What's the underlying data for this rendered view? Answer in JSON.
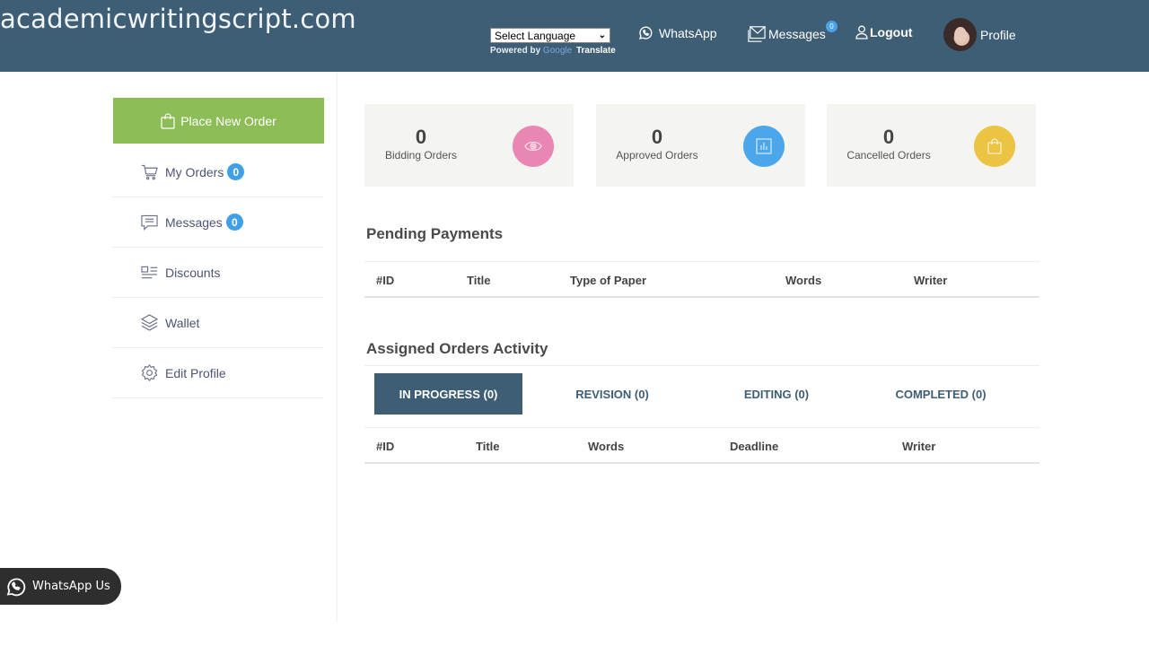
{
  "header": {
    "site_title": "academicwritingscript.com",
    "language_select": {
      "selected": "Select Language"
    },
    "powered_by": "Powered by",
    "google": "Google",
    "translate": "Translate",
    "nav": {
      "whatsapp": "WhatsApp",
      "messages": "Messages",
      "messages_badge": "0",
      "logout": "Logout",
      "profile": "Profile"
    }
  },
  "sidebar": {
    "place_order": "Place New Order",
    "items": [
      {
        "label": "My Orders",
        "icon": "cart-icon",
        "badge": "0"
      },
      {
        "label": "Messages",
        "icon": "chat-icon",
        "badge": "0"
      },
      {
        "label": "Discounts",
        "icon": "discount-list-icon"
      },
      {
        "label": "Wallet",
        "icon": "layers-icon"
      },
      {
        "label": "Edit Profile",
        "icon": "gear-icon"
      }
    ]
  },
  "stats": [
    {
      "value": "0",
      "label": "Bidding Orders",
      "icon": "eye-icon",
      "color": "#ea86b3"
    },
    {
      "value": "0",
      "label": "Approved Orders",
      "icon": "chart-icon",
      "color": "#4ba7ea"
    },
    {
      "value": "0",
      "label": "Cancelled Orders",
      "icon": "bag-icon",
      "color": "#ecc443"
    }
  ],
  "pending_payments": {
    "title": "Pending Payments",
    "columns": [
      "#ID",
      "Title",
      "Type of Paper",
      "Words",
      "Writer"
    ],
    "rows": []
  },
  "assigned_orders": {
    "title": "Assigned Orders Activity",
    "tabs": [
      {
        "label": "IN PROGRESS (0)",
        "active": true
      },
      {
        "label": "REVISION (0)",
        "active": false
      },
      {
        "label": "EDITING (0)",
        "active": false
      },
      {
        "label": "COMPLETED (0)",
        "active": false
      }
    ],
    "columns": [
      "#ID",
      "Title",
      "Words",
      "Deadline",
      "Writer"
    ],
    "rows": []
  },
  "floating_whatsapp": {
    "label": "WhatsApp Us"
  },
  "colors": {
    "header_bg": "#3e5e75",
    "accent_green": "#8cbd57",
    "badge_blue": "#3fa0e6"
  }
}
